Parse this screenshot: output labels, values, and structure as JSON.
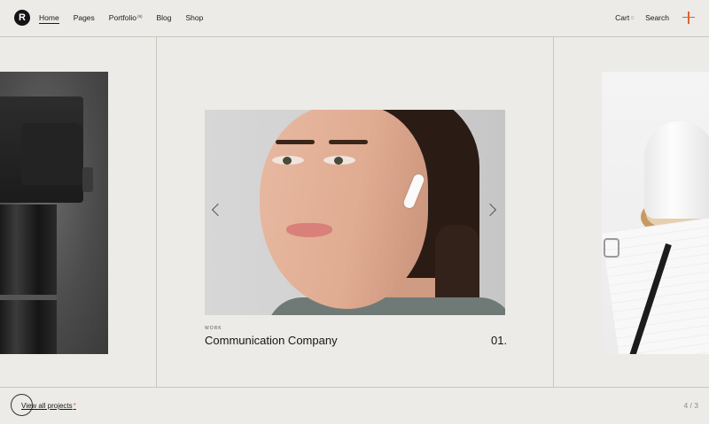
{
  "header": {
    "logo_letter": "R",
    "nav": [
      {
        "label": "Home",
        "active": true
      },
      {
        "label": "Pages"
      },
      {
        "label": "Portfolio",
        "badge": "(9)"
      },
      {
        "label": "Blog"
      },
      {
        "label": "Shop"
      }
    ],
    "cart_label": "Cart",
    "cart_count": "0",
    "search_label": "Search",
    "menu_icon": "plus-icon",
    "accent_color": "#e0632e"
  },
  "slider": {
    "category": "WORK",
    "title": "Communication Company",
    "number": "01.",
    "prev_icon": "chevron-left-icon",
    "next_icon": "chevron-right-icon"
  },
  "footer": {
    "view_all_label": "View all projects",
    "pager": "4 / 3"
  }
}
